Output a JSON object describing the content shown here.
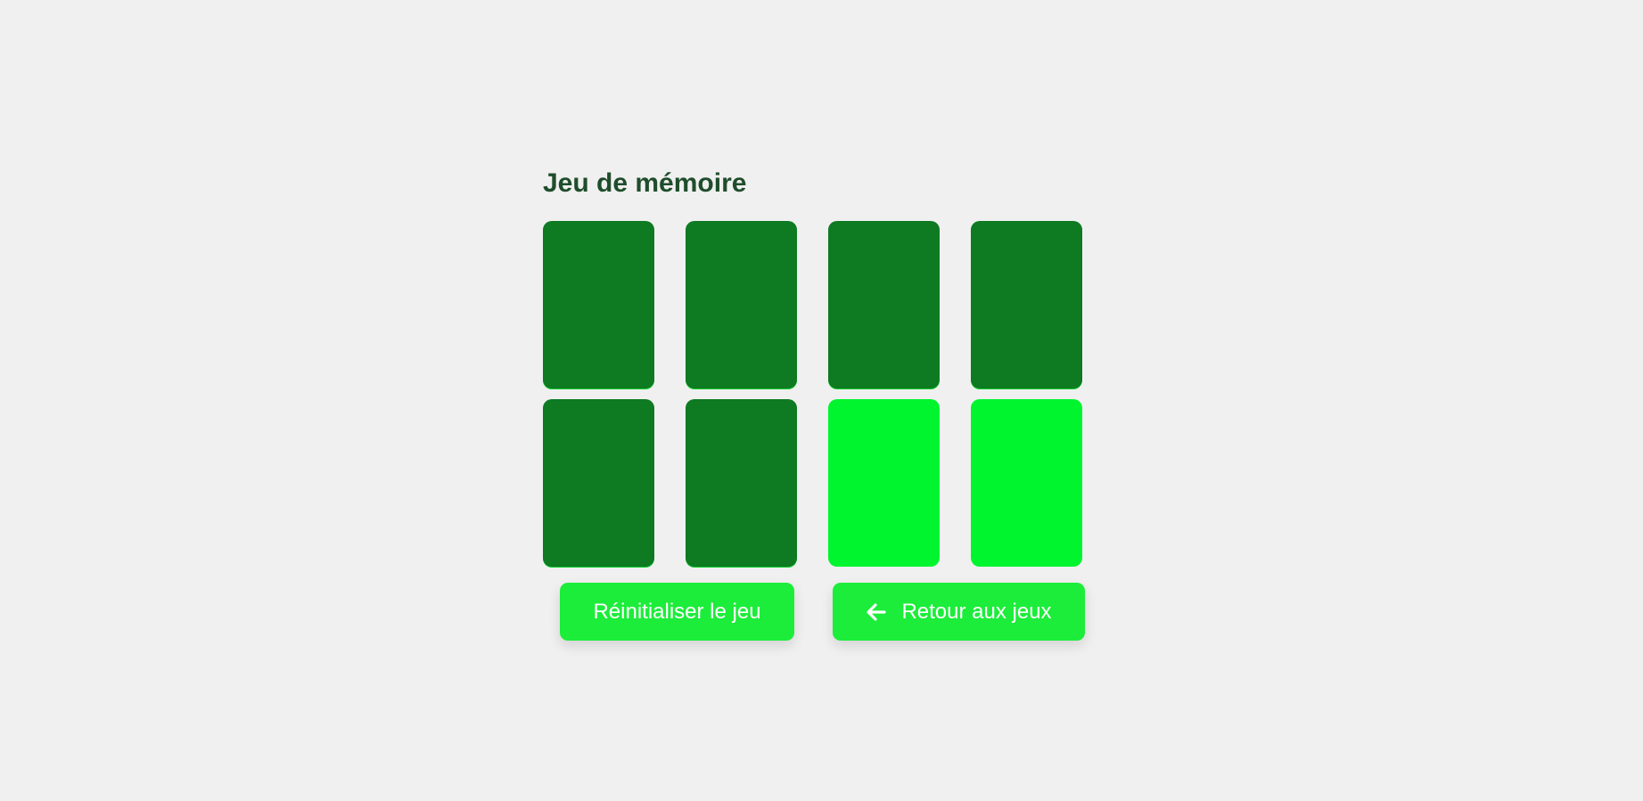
{
  "game": {
    "title": "Jeu de mémoire",
    "cards": [
      {
        "state": "hidden",
        "color": "#0e7a22"
      },
      {
        "state": "hidden",
        "color": "#0e7a22"
      },
      {
        "state": "hidden",
        "color": "#0e7a22"
      },
      {
        "state": "hidden",
        "color": "#0e7a22"
      },
      {
        "state": "hidden",
        "color": "#0e7a22"
      },
      {
        "state": "hidden",
        "color": "#0e7a22"
      },
      {
        "state": "revealed",
        "color": "#00f52e"
      },
      {
        "state": "revealed",
        "color": "#00f52e"
      }
    ]
  },
  "actions": {
    "reset_label": "Réinitialiser le jeu",
    "back_label": "Retour aux jeux",
    "back_icon": "arrow-left-icon"
  },
  "colors": {
    "background": "#f0f0f0",
    "title": "#1f4d2b",
    "card_hidden": "#0e7a22",
    "card_revealed": "#00f52e",
    "button": "#1ced3a"
  }
}
